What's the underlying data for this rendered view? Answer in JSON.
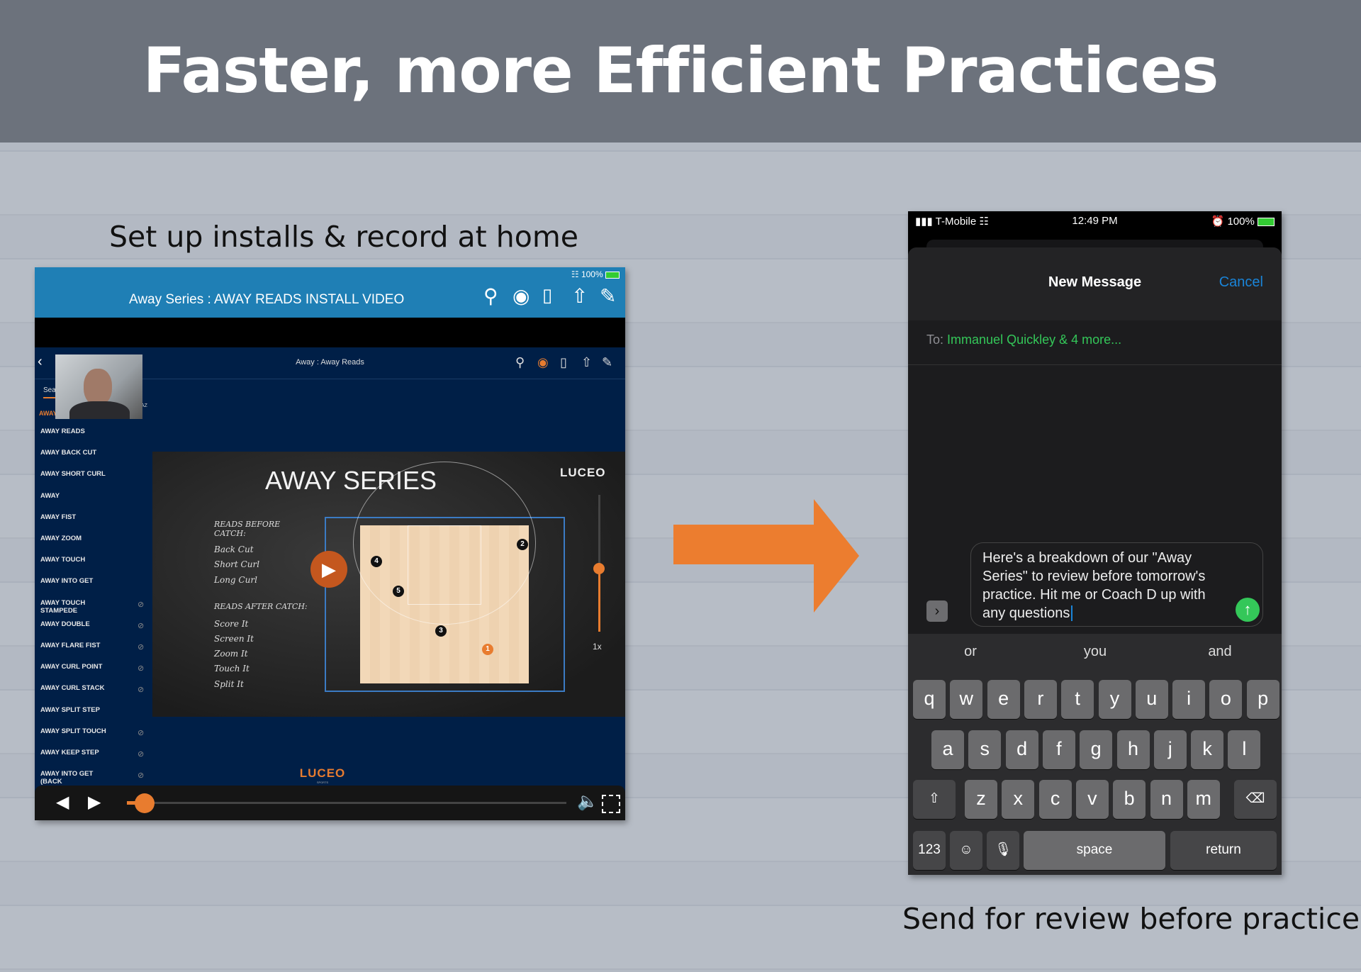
{
  "title": "Faster, more Efficient Practices",
  "left_caption": "Set up installs & record at home",
  "right_caption": "Send for review before practice",
  "colors": {
    "accent_orange": "#e87c2f",
    "ipad_header": "#1f7fb5",
    "navy": "#001f47",
    "imessage_green": "#34c759",
    "ios_blue": "#1a84d8"
  },
  "ipad": {
    "status": "100%",
    "header_title": "Away Series : AWAY READS INSTALL VIDEO",
    "header_icons": [
      "search-icon",
      "record-icon",
      "clipboard-icon",
      "share-icon",
      "highlighter-icon"
    ],
    "inner_title": "Away : Away Reads",
    "search_placeholder": "Sea",
    "sort_label": "AZ",
    "active_item": "AWAY",
    "sidebar_items": [
      {
        "label": "AWAY READS",
        "restricted": false
      },
      {
        "label": "AWAY BACK CUT",
        "restricted": false
      },
      {
        "label": "AWAY SHORT CURL",
        "restricted": false
      },
      {
        "label": "AWAY",
        "restricted": false
      },
      {
        "label": "AWAY FIST",
        "restricted": false
      },
      {
        "label": "AWAY ZOOM",
        "restricted": false
      },
      {
        "label": "AWAY TOUCH",
        "restricted": false
      },
      {
        "label": "AWAY INTO GET",
        "restricted": false
      },
      {
        "label": "AWAY TOUCH STAMPEDE",
        "restricted": true
      },
      {
        "label": "AWAY DOUBLE",
        "restricted": true
      },
      {
        "label": "AWAY FLARE FIST",
        "restricted": true
      },
      {
        "label": "AWAY CURL POINT",
        "restricted": true
      },
      {
        "label": "AWAY CURL STACK",
        "restricted": true
      },
      {
        "label": "AWAY SPLIT STEP",
        "restricted": false
      },
      {
        "label": "AWAY SPLIT TOUCH",
        "restricted": true
      },
      {
        "label": "AWAY KEEP STEP",
        "restricted": true
      },
      {
        "label": "AWAY INTO GET (BACK",
        "restricted": true
      }
    ],
    "slide": {
      "title": "AWAY SERIES",
      "brand": "LUCEO",
      "speed": "1x",
      "reads_before_heading": "READS BEFORE CATCH:",
      "reads_before": [
        "Back Cut",
        "Short Curl",
        "Long Curl"
      ],
      "reads_after_heading": "READS AFTER CATCH:",
      "reads_after": [
        "Score It",
        "Screen It",
        "Zoom It",
        "Touch It",
        "Split It"
      ],
      "players": [
        "4",
        "2",
        "5",
        "3",
        "1"
      ]
    },
    "footer_brand": "LUCEO",
    "footer_sub": "SPORTS",
    "progress": 0.03
  },
  "phone": {
    "carrier": "T-Mobile",
    "time": "12:49 PM",
    "battery": "100%",
    "sheet_title": "New Message",
    "cancel": "Cancel",
    "to_label": "To:",
    "recipients": "Immanuel Quickley & 4 more...",
    "message": "Here's a breakdown of our \"Away Series\" to review before tomorrow's practice. Hit me or Coach D up with any questions",
    "suggestions": [
      "or",
      "you",
      "and"
    ],
    "keys": [
      [
        "q",
        "w",
        "e",
        "r",
        "t",
        "y",
        "u",
        "i",
        "o",
        "p"
      ],
      [
        "a",
        "s",
        "d",
        "f",
        "g",
        "h",
        "j",
        "k",
        "l"
      ],
      [
        "z",
        "x",
        "c",
        "v",
        "b",
        "n",
        "m"
      ]
    ],
    "numbers_key": "123",
    "space_key": "space",
    "return_key": "return"
  }
}
